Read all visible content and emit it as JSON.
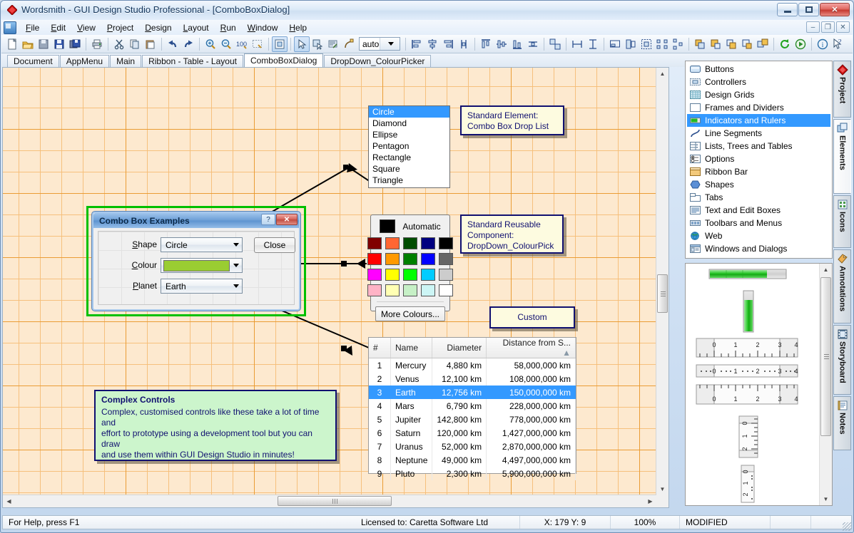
{
  "window": {
    "title": "Wordsmith - GUI Design Studio Professional - [ComboBoxDialog]",
    "minimize": "–",
    "maximize": "□",
    "close": "✕"
  },
  "menu": {
    "items": [
      "File",
      "Edit",
      "View",
      "Project",
      "Design",
      "Layout",
      "Run",
      "Window",
      "Help"
    ],
    "mdi_buttons": [
      "–",
      "❐",
      "✕"
    ]
  },
  "toolbar": {
    "zoom_value": "auto",
    "icons": [
      "new-document-icon",
      "open-folder-icon",
      "save-copy-icon",
      "save-icon",
      "save-all-icon",
      "print-icon",
      "cut-icon",
      "copy-icon",
      "paste-icon",
      "undo-icon",
      "redo-icon",
      "zoom-in-icon",
      "zoom-out-icon",
      "zoom-100-icon",
      "zoom-region-icon",
      "fit-page-icon",
      "select-tool-icon",
      "select-element-icon",
      "annotate-icon",
      "connector-icon"
    ],
    "align_icons": [
      "align-left-icon",
      "align-center-icon",
      "align-right-icon",
      "distribute-h-icon",
      "align-top-icon",
      "align-middle-icon",
      "align-bottom-icon",
      "distribute-v-icon",
      "swap-icon",
      "same-width-icon",
      "same-height-icon",
      "size-to-grid-icon",
      "size-height-icon",
      "size-both-icon",
      "space-across-icon",
      "space-down-icon",
      "bring-front-icon",
      "bring-forward-icon",
      "send-backward-icon",
      "send-back-icon",
      "group-icon",
      "refresh-icon",
      "run-icon",
      "about-icon",
      "help-cursor-icon"
    ]
  },
  "doc_tabs": {
    "tabs": [
      "Document",
      "AppMenu",
      "Main",
      "Ribbon - Table - Layout",
      "ComboBoxDialog",
      "DropDown_ColourPicker"
    ],
    "active": "ComboBoxDialog"
  },
  "design": {
    "dialog": {
      "title": "Combo Box Examples",
      "help_button": "?",
      "close_button": "✕",
      "fields": [
        {
          "label": "Shape",
          "accesskey": "S",
          "value": "Circle"
        },
        {
          "label": "Colour",
          "accesskey": "C",
          "value": "",
          "swatch": "#9acd32"
        },
        {
          "label": "Planet",
          "accesskey": "P",
          "value": "Earth"
        }
      ],
      "close_label": "Close"
    },
    "shape_droplist": {
      "items": [
        "Circle",
        "Diamond",
        "Ellipse",
        "Pentagon",
        "Rectangle",
        "Square",
        "Triangle"
      ],
      "selected": "Circle"
    },
    "colour_picker": {
      "automatic_label": "Automatic",
      "automatic_swatch": "#000000",
      "more_label": "More Colours...",
      "swatches": [
        [
          "#800000",
          "#FF6633",
          "#004C00",
          "#000080",
          "#000000"
        ],
        [
          "#FF0000",
          "#FF9900",
          "#008000",
          "#0000FF",
          "#666666"
        ],
        [
          "#FF00FF",
          "#FFFF00",
          "#00FF00",
          "#00CCFF",
          "#CCCCCC"
        ],
        [
          "#FFB3C6",
          "#FFFFB3",
          "#C6F0C6",
          "#CCF5F5",
          "#FFFFFF"
        ]
      ]
    },
    "callouts": [
      {
        "name": "combo-box-drop-list-callout",
        "lines": [
          "Standard Element:",
          "Combo Box Drop List"
        ]
      },
      {
        "name": "colour-picker-callout",
        "lines": [
          "Standard Reusable",
          "Component:",
          "DropDown_ColourPick"
        ]
      },
      {
        "name": "custom-callout",
        "lines": [
          "Custom"
        ]
      },
      {
        "name": "complex-controls-callout",
        "heading": "Complex Controls",
        "lines": [
          "Complex, customised controls like these take a lot of time and",
          "effort to prototype using a development tool but you can draw",
          "and use them within GUI Design Studio in minutes!"
        ]
      }
    ],
    "planet_table": {
      "columns": [
        "#",
        "Name",
        "Diameter",
        "Distance from S...",
        "sort-ascending-icon"
      ],
      "selected_row": 3,
      "rows": [
        {
          "n": "1",
          "name": "Mercury",
          "diameter": "4,880 km",
          "distance": "58,000,000 km"
        },
        {
          "n": "2",
          "name": "Venus",
          "diameter": "12,100 km",
          "distance": "108,000,000 km"
        },
        {
          "n": "3",
          "name": "Earth",
          "diameter": "12,756 km",
          "distance": "150,000,000 km"
        },
        {
          "n": "4",
          "name": "Mars",
          "diameter": "6,790 km",
          "distance": "228,000,000 km"
        },
        {
          "n": "5",
          "name": "Jupiter",
          "diameter": "142,800 km",
          "distance": "778,000,000 km"
        },
        {
          "n": "6",
          "name": "Saturn",
          "diameter": "120,000 km",
          "distance": "1,427,000,000 km"
        },
        {
          "n": "7",
          "name": "Uranus",
          "diameter": "52,000 km",
          "distance": "2,870,000,000 km"
        },
        {
          "n": "8",
          "name": "Neptune",
          "diameter": "49,000 km",
          "distance": "4,497,000,000 km"
        },
        {
          "n": "9",
          "name": "Pluto",
          "diameter": "2,300 km",
          "distance": "5,900,000,000 km"
        }
      ]
    }
  },
  "elements_panel": {
    "items": [
      {
        "label": "Buttons",
        "icon": "button-icon"
      },
      {
        "label": "Controllers",
        "icon": "controller-icon"
      },
      {
        "label": "Design Grids",
        "icon": "grid-icon"
      },
      {
        "label": "Frames and Dividers",
        "icon": "frame-icon"
      },
      {
        "label": "Indicators and Rulers",
        "icon": "indicator-icon"
      },
      {
        "label": "Line Segments",
        "icon": "line-segment-icon"
      },
      {
        "label": "Lists, Trees and Tables",
        "icon": "list-icon"
      },
      {
        "label": "Options",
        "icon": "radio-options-icon"
      },
      {
        "label": "Ribbon Bar",
        "icon": "ribbon-icon"
      },
      {
        "label": "Shapes",
        "icon": "shape-icon"
      },
      {
        "label": "Tabs",
        "icon": "tab-icon"
      },
      {
        "label": "Text and Edit Boxes",
        "icon": "text-box-icon"
      },
      {
        "label": "Toolbars and Menus",
        "icon": "toolbar-icon"
      },
      {
        "label": "Web",
        "icon": "globe-icon"
      },
      {
        "label": "Windows and Dialogs",
        "icon": "window-icon"
      }
    ],
    "selected": "Indicators and Rulers"
  },
  "preview_panel": {
    "items": [
      "progress-bar-horizontal",
      "progress-bar-vertical",
      "ruler-ticks-below",
      "ruler-ticks-inline",
      "ruler-ticks-above",
      "ruler-vertical",
      "ruler-vertical-thin"
    ],
    "ruler_labels": [
      "0",
      "1",
      "2",
      "3",
      "4"
    ]
  },
  "vertical_tabs": {
    "tabs": [
      {
        "label": "Project",
        "icon": "project-diamond-icon"
      },
      {
        "label": "Elements",
        "icon": "elements-icon"
      },
      {
        "label": "Icons",
        "icon": "icons-icon"
      },
      {
        "label": "Annotations",
        "icon": "annotations-icon"
      },
      {
        "label": "Storyboard",
        "icon": "storyboard-icon"
      },
      {
        "label": "Notes",
        "icon": "notes-icon"
      }
    ],
    "active": "Elements"
  },
  "statusbar": {
    "hint": "For Help, press F1",
    "license": "Licensed to: Caretta Software Ltd",
    "coords": "X: 179  Y: 9",
    "zoom": "100%",
    "modified": "MODIFIED"
  }
}
